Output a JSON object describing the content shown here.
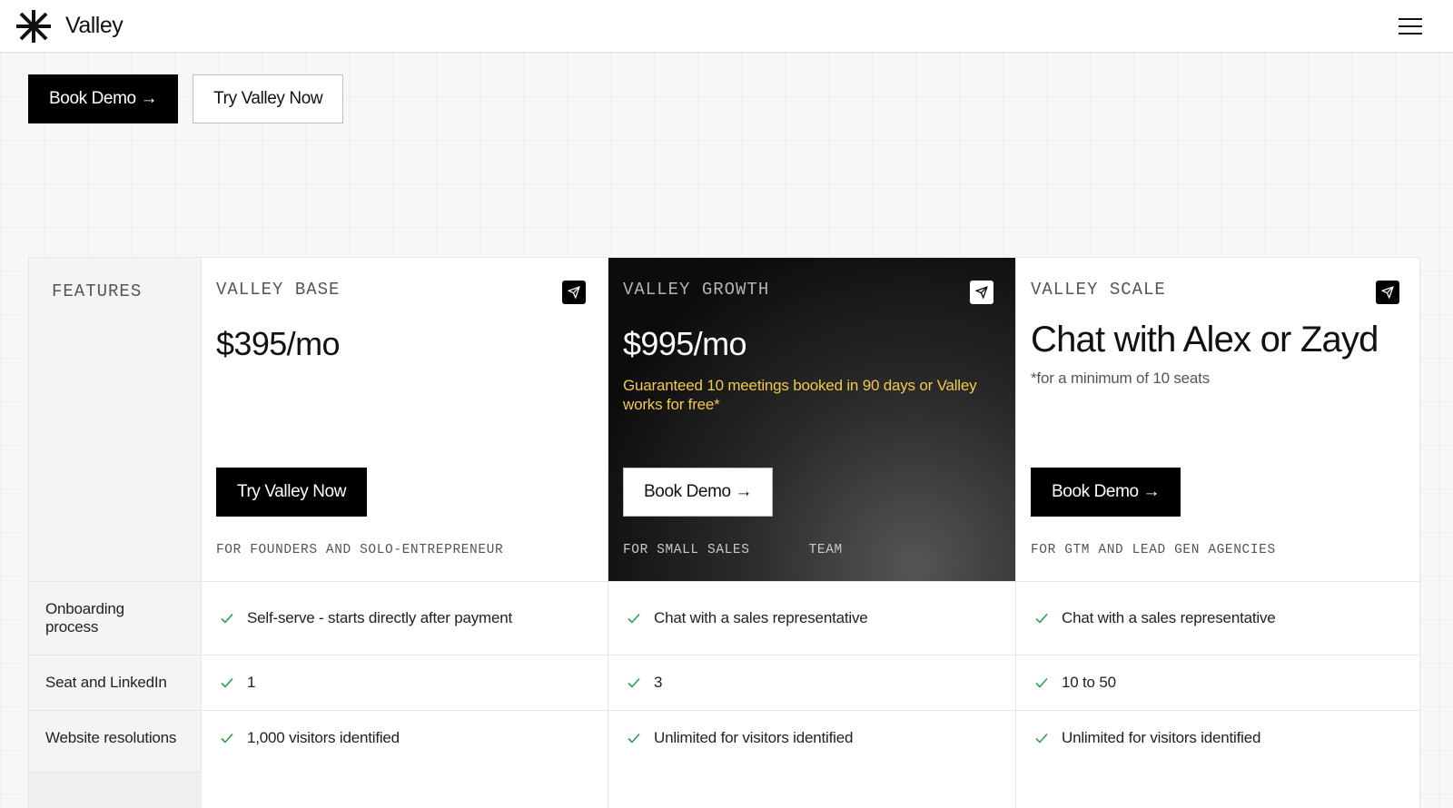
{
  "header": {
    "brand": "Valley"
  },
  "hero": {
    "book_demo": "Book Demo →",
    "try_now": "Try Valley Now"
  },
  "table": {
    "features_label": "FEATURES",
    "plans": [
      {
        "name": "VALLEY BASE",
        "price": "$395/mo",
        "button": "Try Valley Now",
        "audience": "FOR FOUNDERS AND SOLO-ENTREPRENEUR"
      },
      {
        "name": "VALLEY GROWTH",
        "price": "$995/mo",
        "tagline": "Guaranteed 10 meetings booked in 90 days or Valley works for free*",
        "button": "Book Demo →",
        "audience": "FOR SMALL SALES       TEAM"
      },
      {
        "name": "VALLEY SCALE",
        "price": "Chat with Alex or Zayd",
        "note": "*for a minimum of 10 seats",
        "button": "Book Demo →",
        "audience": "FOR GTM AND LEAD GEN AGENCIES"
      }
    ],
    "rows": [
      {
        "feature": "Onboarding process",
        "values": [
          "Self-serve - starts directly after payment",
          "Chat with a sales representative",
          "Chat with a sales representative"
        ]
      },
      {
        "feature": "Seat and LinkedIn",
        "values": [
          "1",
          "3",
          "10 to 50"
        ]
      },
      {
        "feature": "Website resolutions",
        "values": [
          "1,000 visitors identified",
          "Unlimited for visitors identified",
          "Unlimited for visitors identified"
        ]
      }
    ]
  },
  "colors": {
    "accent_yellow": "#f2c94c",
    "check_green": "#2e9d4e"
  },
  "icons": {
    "logo": "valley-logo-icon",
    "menu": "hamburger-menu-icon",
    "send": "send-icon",
    "check": "check-icon"
  }
}
